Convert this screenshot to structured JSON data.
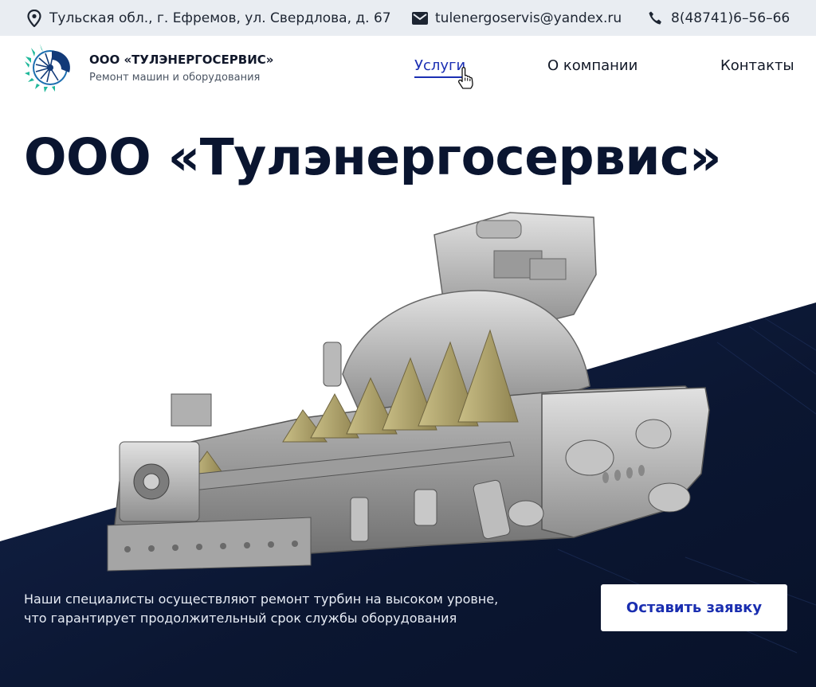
{
  "topbar": {
    "address": "Тульская обл., г. Ефремов, ул. Свердлова, д. 67",
    "email": "tulenergoservis@yandex.ru",
    "phone": "8(48741)6–56–66",
    "icons": [
      "location-pin-icon",
      "mail-icon",
      "phone-icon"
    ]
  },
  "header": {
    "logo_title": "ООО «ТУЛЭНЕРГОСЕРВИС»",
    "logo_subtitle": "Ремонт машин и оборудования",
    "nav": [
      {
        "label": "Услуги",
        "active": true
      },
      {
        "label": "О компании",
        "active": false
      },
      {
        "label": "Контакты",
        "active": false
      }
    ]
  },
  "hero": {
    "title": "ООО «Тулэнергосервис»",
    "description_line1": "Наши специалисты осуществляют ремонт турбин на высоком уровне,",
    "description_line2": "что гарантирует продолжительный срок службы оборудования",
    "cta_label": "Оставить заявку"
  },
  "colors": {
    "topbar_bg": "#e9edf2",
    "dark_bg": "#0c1834",
    "accent": "#1b2fb3",
    "title": "#0a1530"
  }
}
